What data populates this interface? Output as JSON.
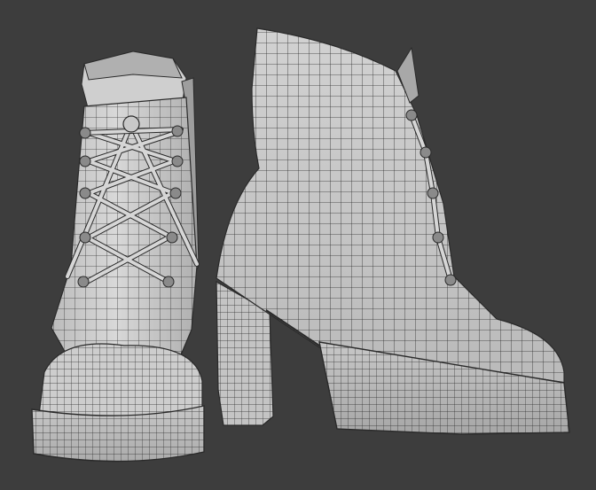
{
  "viewport": {
    "background": "#3d3d3d",
    "shading": "solid-gray-wireframe"
  },
  "colors": {
    "surface": "#c8c8c8",
    "surface_light": "#dcdcdc",
    "surface_dark": "#9a9a9a",
    "wire": "#2a2a2a",
    "lace": "#d6d6d6",
    "eyelet": "#8a8a8a"
  },
  "objects": [
    {
      "name": "combat-boot",
      "view": "front",
      "has_laces": true
    },
    {
      "name": "platform-heel-boot",
      "view": "side",
      "has_laces": true
    }
  ]
}
